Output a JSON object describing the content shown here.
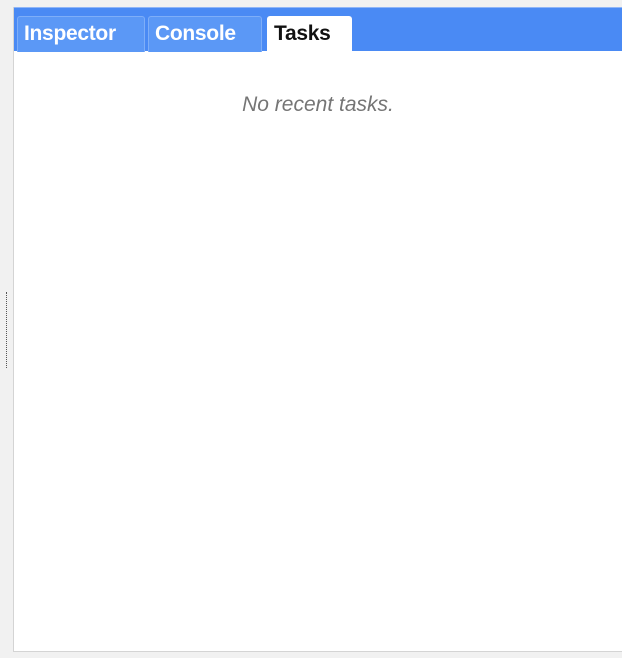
{
  "tabs": [
    {
      "label": "Inspector",
      "active": false
    },
    {
      "label": "Console",
      "active": false
    },
    {
      "label": "Tasks",
      "active": true
    }
  ],
  "tasks_panel": {
    "empty_message": "No recent tasks."
  },
  "colors": {
    "tabbar_background": "#4a8af4",
    "inactive_tab_background": "#5b98f6",
    "active_tab_background": "#ffffff",
    "empty_message_text": "#757575"
  }
}
